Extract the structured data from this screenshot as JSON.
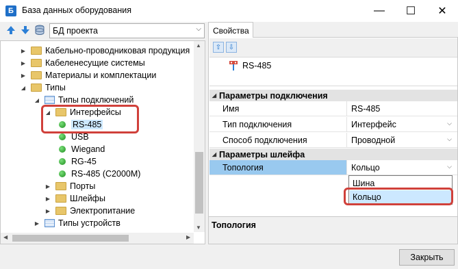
{
  "window": {
    "title": "База данных оборудования",
    "minimize": "—",
    "maximize": "☐",
    "close": "✕"
  },
  "left": {
    "combo_value": "БД проекта",
    "tree": [
      {
        "label": "Кабельно-проводниковая продукция",
        "type": "folder",
        "expander": "▶"
      },
      {
        "label": "Кабеленесущие системы",
        "type": "folder",
        "expander": "▶"
      },
      {
        "label": "Материалы и комплектации",
        "type": "folder",
        "expander": "▶"
      },
      {
        "label": "Типы",
        "type": "folder",
        "expander": "◢"
      },
      {
        "label": "Типы подключений",
        "type": "grid",
        "expander": "◢"
      },
      {
        "label": "Интерфейсы",
        "type": "folder",
        "expander": "◢"
      },
      {
        "label": "RS-485",
        "type": "dot",
        "selected": true
      },
      {
        "label": "USB",
        "type": "dot"
      },
      {
        "label": "Wiegand",
        "type": "dot"
      },
      {
        "label": "RG-45",
        "type": "dot"
      },
      {
        "label": "RS-485 (C2000M)",
        "type": "dot"
      },
      {
        "label": "Порты",
        "type": "folder",
        "expander": "▶"
      },
      {
        "label": "Шлейфы",
        "type": "folder",
        "expander": "▶"
      },
      {
        "label": "Электропитание",
        "type": "folder",
        "expander": "▶"
      },
      {
        "label": "Типы устройств",
        "type": "grid",
        "expander": "▶"
      }
    ]
  },
  "right": {
    "tab": "Свойства",
    "object_name": "RS-485",
    "categories": [
      {
        "title": "Параметры подключения",
        "props": [
          {
            "name": "Имя",
            "value": "RS-485",
            "dropdown": false
          },
          {
            "name": "Тип подключения",
            "value": "Интерфейс",
            "dropdown": true
          },
          {
            "name": "Способ подключения",
            "value": "Проводной",
            "dropdown": true
          }
        ]
      },
      {
        "title": "Параметры шлейфа",
        "props": [
          {
            "name": "Топология",
            "value": "Кольцо",
            "dropdown": true,
            "selected": true
          }
        ]
      }
    ],
    "dropdown_options": [
      "Шина",
      "Кольцо"
    ],
    "description_title": "Топология"
  },
  "buttons": {
    "close": "Закрыть"
  },
  "colors": {
    "highlight": "#d0403a",
    "selection": "#cce8ff",
    "prop_selection": "#99c9ef"
  }
}
